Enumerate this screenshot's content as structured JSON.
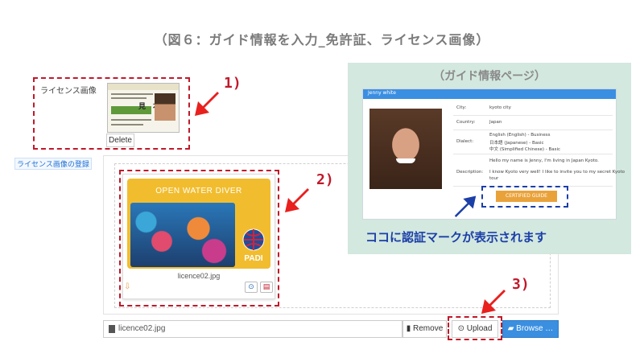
{
  "title": "（図６：ガイド情報を入力_免許証、ライセンス画像）",
  "license": {
    "label": "ライセンス画像",
    "card_text": "見　本",
    "delete_label": "Delete"
  },
  "register_link": "ライセンス画像の登録",
  "preview": {
    "card_title": "OPEN WATER DIVER",
    "logo_text": "PADI",
    "filename": "licence02.jpg"
  },
  "file_bar": {
    "filename": "licence02.jpg",
    "remove_label": "Remove",
    "upload_label": "Upload",
    "browse_label": "Browse …"
  },
  "steps": [
    "1)",
    "2)",
    "3)"
  ],
  "guide": {
    "heading": "（ガイド情報ページ）",
    "name": "Jenny white",
    "rows": [
      {
        "label": "City:",
        "value": "kyoto city"
      },
      {
        "label": "Country:",
        "value": "Japan"
      },
      {
        "label": "Dialect:",
        "value": "English (English) - Business"
      },
      {
        "label": "",
        "value": "日本語 (Japanese) - Basic"
      },
      {
        "label": "",
        "value": "中文 (Simplified Chinese) - Basic"
      },
      {
        "label": "",
        "value": "Hello my name is Jenny, I'm living in Japan Kyoto."
      },
      {
        "label": "Description:",
        "value": "I know Kyoto very well! I like to invite you to my secret Kyoto"
      },
      {
        "label": "",
        "value": "tour"
      }
    ],
    "cert_label": "CERTIFIED GUIDE",
    "caption": "ココに認証マークが表示されます"
  },
  "colors": {
    "accent_red": "#c0192a",
    "accent_blue": "#1b3fa8",
    "browse_blue": "#3a8fe0",
    "panel_green": "#d3e8df"
  }
}
